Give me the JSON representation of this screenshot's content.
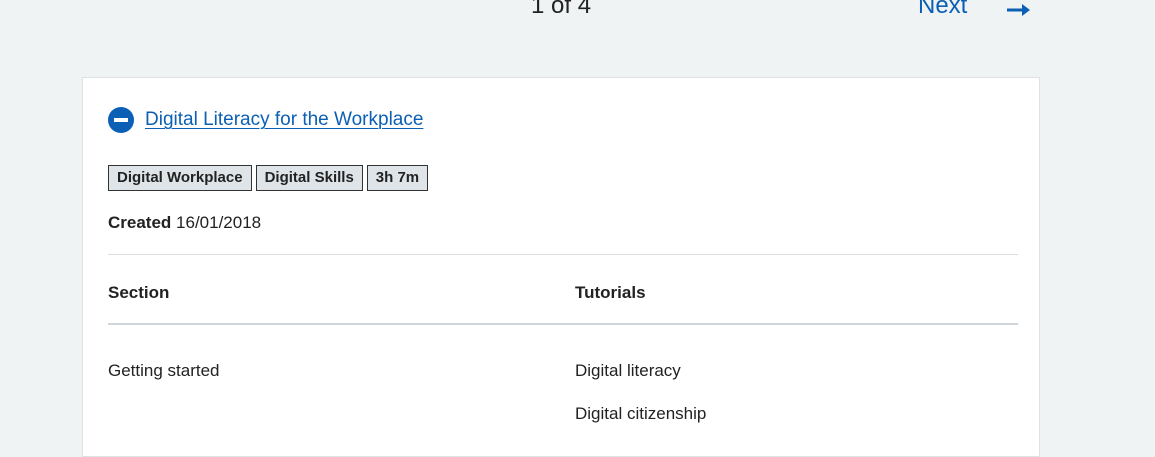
{
  "pager": {
    "page_count": "1 of 4",
    "next_label": "Next",
    "next_icon": "arrow-right-icon",
    "link_color": "#0b5fb4"
  },
  "course": {
    "title": "Digital Literacy for the Workplace",
    "toggle_icon": "minus-circle-icon",
    "tags": [
      "Digital Workplace",
      "Digital Skills",
      "3h 7m"
    ],
    "created_label": "Created",
    "created_date": "16/01/2018"
  },
  "table": {
    "headers": {
      "section": "Section",
      "tutorials": "Tutorials"
    },
    "rows": [
      {
        "section": "Getting started",
        "tutorials": [
          "Digital literacy",
          "Digital citizenship"
        ]
      }
    ]
  }
}
